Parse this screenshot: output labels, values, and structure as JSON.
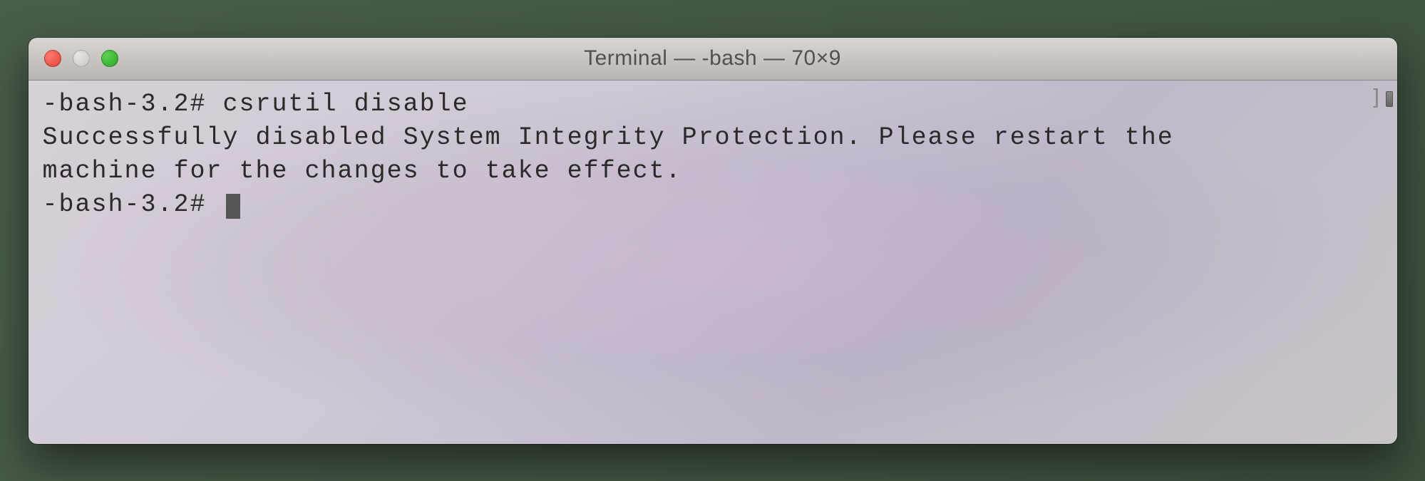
{
  "window": {
    "title": "Terminal — -bash — 70×9"
  },
  "terminal": {
    "prompt1": "-bash-3.2# ",
    "command1": "csrutil disable",
    "output_line1": "Successfully disabled System Integrity Protection. Please restart the ",
    "output_line2": "machine for the changes to take effect.",
    "prompt2": "-bash-3.2# "
  }
}
